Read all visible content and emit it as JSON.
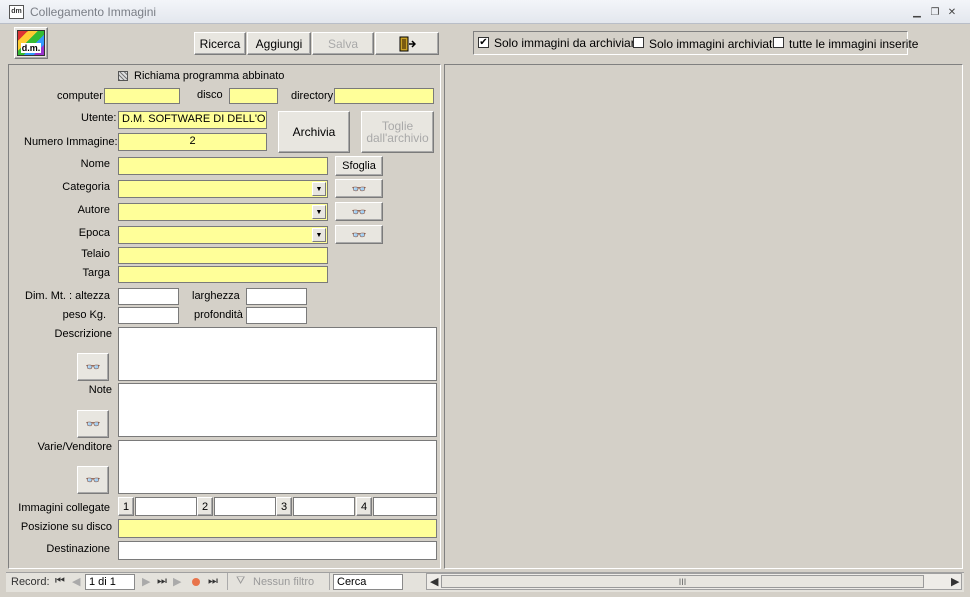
{
  "window": {
    "title": "Collegamento Immagini",
    "app_icon_text": "dm"
  },
  "toolbar": {
    "logo_text": "d.m.",
    "ricerca": "Ricerca",
    "aggiungi": "Aggiungi",
    "salva": "Salva"
  },
  "filters": {
    "solo_da_archiviare": {
      "label": "Solo immagini da archiviare",
      "checked": true
    },
    "solo_archiviate": {
      "label": "Solo immagini archiviate",
      "checked": false
    },
    "tutte_inserite": {
      "label": "tutte le immagini inserite",
      "checked": false
    }
  },
  "form": {
    "richiama_label": "Richiama programma abbinato",
    "computer_label": "computer",
    "computer_value": "",
    "disco_label": "disco",
    "disco_value": "",
    "directory_label": "directory",
    "directory_value": "",
    "utente_label": "Utente:",
    "utente_value": "D.M. SOFTWARE DI DELL'O",
    "numero_label": "Numero Immagine:",
    "numero_value": "2",
    "archivia": "Archivia",
    "togli_line1": "Toglie",
    "togli_line2": "dall'archivio",
    "nome_label": "Nome",
    "nome_value": "",
    "sfoglia": "Sfoglia",
    "categoria_label": "Categoria",
    "categoria_value": "",
    "autore_label": "Autore",
    "autore_value": "",
    "epoca_label": "Epoca",
    "epoca_value": "",
    "telaio_label": "Telaio",
    "telaio_value": "",
    "targa_label": "Targa",
    "targa_value": "",
    "dim_label": "Dim. Mt. : altezza",
    "altezza_value": "",
    "larghezza_label": "larghezza",
    "larghezza_value": "",
    "peso_label": "peso Kg.",
    "peso_value": "",
    "profondita_label": "profondità",
    "profondita_value": "",
    "descrizione_label": "Descrizione",
    "note_label": "Note",
    "varie_label": "Varie/Venditore",
    "collegate_label": "Immagini collegate",
    "link_buttons": [
      "1",
      "2",
      "3",
      "4"
    ],
    "posizione_label": "Posizione su disco",
    "posizione_value": "",
    "destinazione_label": "Destinazione",
    "destinazione_value": ""
  },
  "statusbar": {
    "record_label": "Record:",
    "record_value": "1 di 1",
    "nessun_filtro": "Nessun filtro",
    "cerca": "Cerca",
    "scroll_grip": "III"
  },
  "colors": {
    "field_yellow": "#ffff99",
    "window_bg": "#d4d0c8"
  }
}
